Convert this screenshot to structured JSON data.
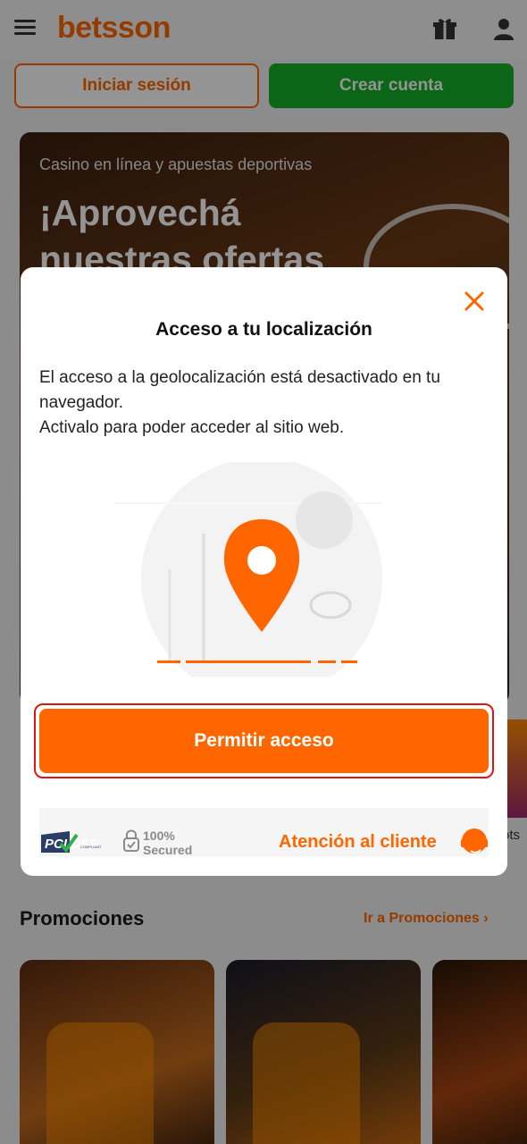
{
  "header": {
    "logo": "betsson",
    "login_label": "Iniciar sesión",
    "register_label": "Crear cuenta"
  },
  "hero": {
    "subtitle": "Casino en línea y apuestas deportivas",
    "title_line1": "¡Aprovechá",
    "title_line2": "nuestras ofertas"
  },
  "side_card": {
    "text": "ots"
  },
  "promotions": {
    "title": "Promociones",
    "link": "Ir a Promociones ›"
  },
  "modal": {
    "title": "Acceso a tu localización",
    "body_line1": "El acceso a la geolocalización está desactivado en tu navegador.",
    "body_line2": "Activalo para poder acceder al sitio web.",
    "allow_button": "Permitir acceso",
    "footer": {
      "pci_label": "PCI DSS",
      "pci_sub": "COMPLIANT",
      "secured_percent": "100%",
      "secured_label": "Secured",
      "support_label": "Atención al cliente"
    }
  },
  "colors": {
    "brand_orange": "#ff6600",
    "register_green": "#13b02a",
    "highlight_red": "#e01414"
  },
  "icons": [
    "menu-icon",
    "gift-icon",
    "user-icon",
    "close-icon",
    "location-pin-icon",
    "lock-icon",
    "headset-icon"
  ]
}
